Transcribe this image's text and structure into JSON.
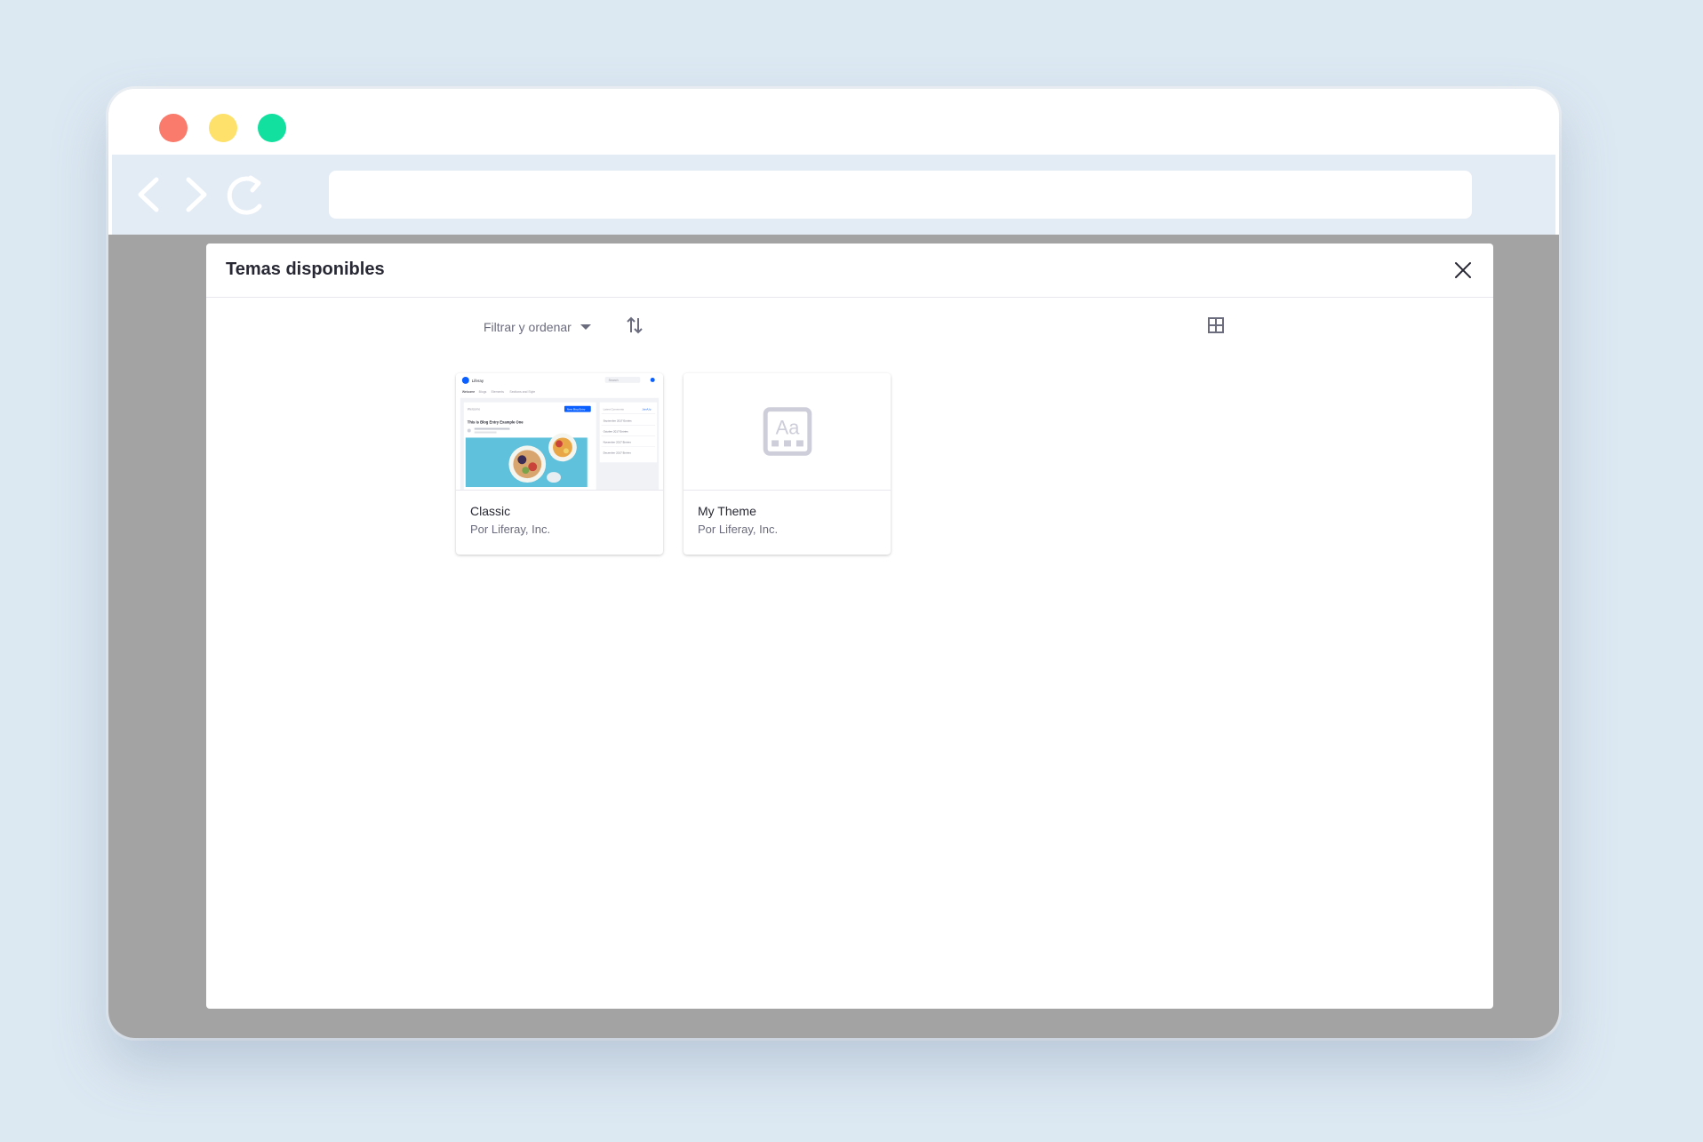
{
  "modal": {
    "title": "Temas disponibles"
  },
  "toolbar": {
    "filter_label": "Filtrar y ordenar"
  },
  "themes": [
    {
      "name": "Classic",
      "author": "Por Liferay, Inc.",
      "preview": {
        "logo": "Liferay",
        "search": "Search",
        "nav": [
          "Welcome",
          "Blogs",
          "Elements",
          "Sections and Style"
        ],
        "page_label": "Welcome",
        "action_label": "New Blog Entry",
        "blog_title": "This is Blog Entry Example One",
        "sidebar_header": "Latest Comments",
        "sidebar_link": "Join/Up",
        "sidebar_items": [
          "September 2017 Entries",
          "October 2017 Entries",
          "November 2017 Entries",
          "December 2017 Entries"
        ]
      }
    },
    {
      "name": "My Theme",
      "author": "Por Liferay, Inc.",
      "placeholder_icon": "Aa"
    }
  ],
  "colors": {
    "page_bg": "#dce8f2",
    "overlay": "#a3a3a3",
    "dot_red": "#fa7a6b",
    "dot_yellow": "#fde16b",
    "dot_green": "#12e09e",
    "accent": "#0b5fff"
  },
  "icons": {
    "back": "chevron-left-icon",
    "forward": "chevron-right-icon",
    "reload": "reload-icon",
    "close": "close-icon",
    "filter_caret": "caret-down-icon",
    "sort": "order-arrows-icon",
    "view": "cards-grid-icon",
    "placeholder": "theme-placeholder-icon"
  }
}
